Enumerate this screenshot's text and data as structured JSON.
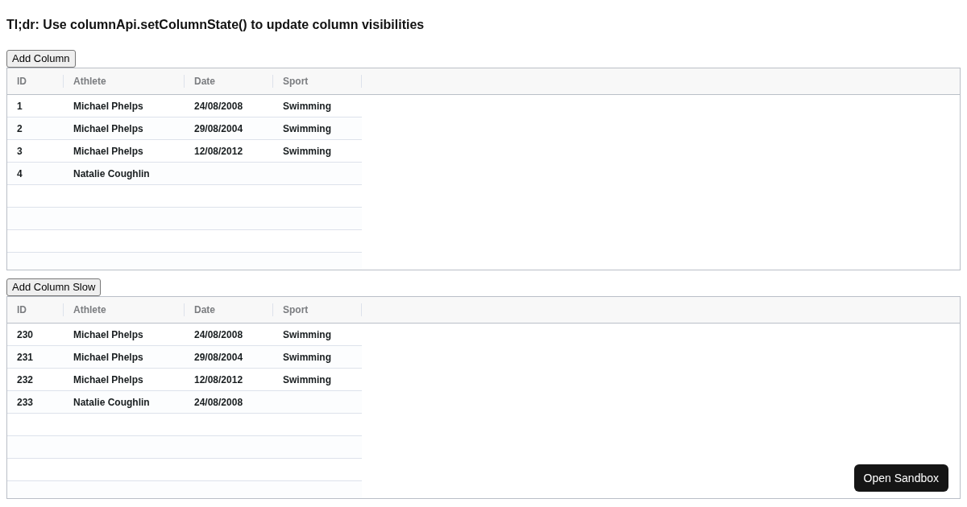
{
  "heading": "Tl;dr: Use columnApi.setColumnState() to update column visibilities",
  "grids": [
    {
      "button": "Add Column",
      "columns": [
        "ID",
        "Athlete",
        "Date",
        "Sport"
      ],
      "rows": [
        {
          "id": "1",
          "athlete": "Michael Phelps",
          "date": "24/08/2008",
          "sport": "Swimming"
        },
        {
          "id": "2",
          "athlete": "Michael Phelps",
          "date": "29/08/2004",
          "sport": "Swimming"
        },
        {
          "id": "3",
          "athlete": "Michael Phelps",
          "date": "12/08/2012",
          "sport": "Swimming"
        },
        {
          "id": "4",
          "athlete": "Natalie Coughlin"
        }
      ]
    },
    {
      "button": "Add Column Slow",
      "columns": [
        "ID",
        "Athlete",
        "Date",
        "Sport"
      ],
      "rows": [
        {
          "id": "230",
          "athlete": "Michael Phelps",
          "date": "24/08/2008",
          "sport": "Swimming"
        },
        {
          "id": "231",
          "athlete": "Michael Phelps",
          "date": "29/08/2004",
          "sport": "Swimming"
        },
        {
          "id": "232",
          "athlete": "Michael Phelps",
          "date": "12/08/2012",
          "sport": "Swimming"
        },
        {
          "id": "233",
          "athlete": "Natalie Coughlin",
          "date": "24/08/2008"
        }
      ]
    }
  ],
  "sandbox_button": "Open Sandbox"
}
